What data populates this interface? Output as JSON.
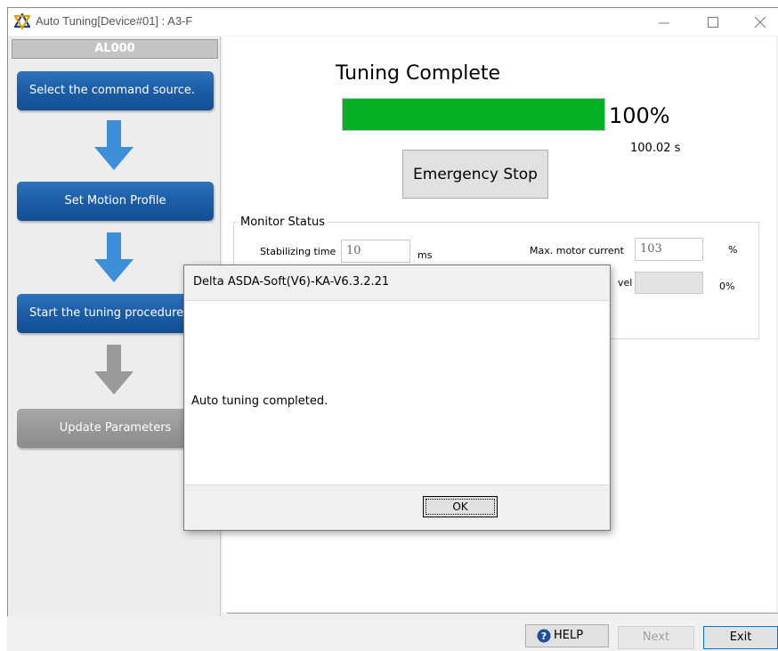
{
  "window": {
    "title": "Auto Tuning[Device#01] : A3-F"
  },
  "left_panel": {
    "alarm_code": "AL000",
    "steps": [
      {
        "label": "Select the command source.",
        "state": "active"
      },
      {
        "label": "Set Motion Profile",
        "state": "active"
      },
      {
        "label": "Start the tuning procedure",
        "state": "active"
      },
      {
        "label": "Update Parameters",
        "state": "disabled"
      }
    ]
  },
  "main": {
    "status_title": "Tuning Complete",
    "progress": {
      "value_percent": 100,
      "label": "100%"
    },
    "elapsed_time": "100.02 s",
    "emergency_stop_label": "Emergency Stop",
    "monitor": {
      "legend": "Monitor Status",
      "stabilizing_time_label": "Stabilizing time",
      "stabilizing_time_value": "10",
      "stabilizing_time_unit": "ms",
      "max_motor_current_label": "Max. motor current",
      "max_motor_current_value": "103",
      "max_motor_current_unit": "%",
      "level_label_partial": "vel",
      "level_value": "",
      "level_unit": "0%"
    }
  },
  "bottom_bar": {
    "help_label": "HELP",
    "next_label": "Next",
    "exit_label": "Exit"
  },
  "dialog": {
    "title": "Delta ASDA-Soft(V6)-KA-V6.3.2.21",
    "message": "Auto tuning completed.",
    "ok_label": "OK"
  },
  "colors": {
    "step_active": "#1d5ea8",
    "step_disabled": "#989898",
    "progress_fill": "#06b025",
    "arrow_active": "#3d8fd8",
    "arrow_disabled": "#9a9a9a",
    "exit_border": "#0078d7"
  },
  "icons": {
    "app": "delta-logo-icon",
    "minimize": "minimize-icon",
    "maximize": "maximize-icon",
    "close": "close-icon",
    "help": "question-circle-icon",
    "arrow": "arrow-down-icon"
  }
}
